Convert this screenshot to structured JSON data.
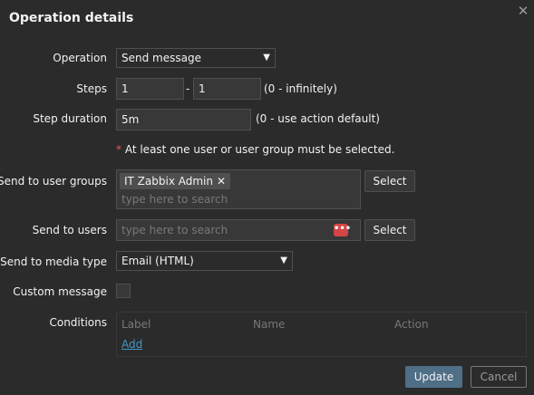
{
  "dialog": {
    "title": "Operation details",
    "close_icon": "close-icon"
  },
  "operation": {
    "label": "Operation",
    "value": "Send message"
  },
  "steps": {
    "label": "Steps",
    "from": "1",
    "separator": "-",
    "to": "1",
    "hint": "(0 - infinitely)"
  },
  "step_duration": {
    "label": "Step duration",
    "value": "5m",
    "hint": "(0 - use action default)"
  },
  "requirement_note": {
    "star": "*",
    "text": "At least one user or user group must be selected."
  },
  "user_groups": {
    "label": "Send to user groups",
    "chips": [
      "IT Zabbix Admin"
    ],
    "chip_remove": "✕",
    "placeholder": "type here to search",
    "select_label": "Select"
  },
  "users": {
    "label": "Send to users",
    "placeholder": "type here to search",
    "more_icon": "more-icon",
    "select_label": "Select"
  },
  "media_type": {
    "label": "Send to media type",
    "value": "Email (HTML)"
  },
  "custom_message": {
    "label": "Custom message",
    "checked": false
  },
  "conditions": {
    "label": "Conditions",
    "columns": [
      "Label",
      "Name",
      "Action"
    ],
    "add_label": "Add"
  },
  "footer": {
    "update_label": "Update",
    "cancel_label": "Cancel"
  },
  "colors": {
    "background": "#2b2b2b",
    "input_background": "#383838",
    "primary_button": "#4f6f86",
    "link": "#4796c4",
    "required": "#e45959"
  }
}
